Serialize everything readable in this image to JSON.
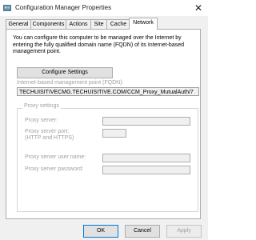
{
  "window": {
    "title": "Configuration Manager Properties",
    "close_glyph": "✕",
    "icon": "control-panel-icon"
  },
  "tabs": [
    {
      "label": "General",
      "active": false
    },
    {
      "label": "Components",
      "active": false
    },
    {
      "label": "Actions",
      "active": false
    },
    {
      "label": "Site",
      "active": false
    },
    {
      "label": "Cache",
      "active": false
    },
    {
      "label": "Network",
      "active": true
    }
  ],
  "network": {
    "description": "You can configure this computer to be managed over the Internet by entering the fully qualified domain name (FQDN) of its Internet-based management point.",
    "configure_button": "Configure Settings",
    "mp_label": "Internet-based management point (FQDN):",
    "mp_value": "TECHUISITIVECMG.TECHUISITIVE.COM/CCM_Proxy_MutualAuth/7",
    "proxy_group": "Proxy settings",
    "proxy_server_label": "Proxy server:",
    "proxy_port_label": "Proxy server port:",
    "proxy_port_sub": "(HTTP and HTTPS)",
    "proxy_user_label": "Proxy server user name:",
    "proxy_password_label": "Proxy server password:"
  },
  "buttons": {
    "ok": "OK",
    "cancel": "Cancel",
    "apply": "Apply"
  },
  "colors": {
    "disabled_text": "#a0a0a0",
    "default_button_border": "#0078d7"
  }
}
